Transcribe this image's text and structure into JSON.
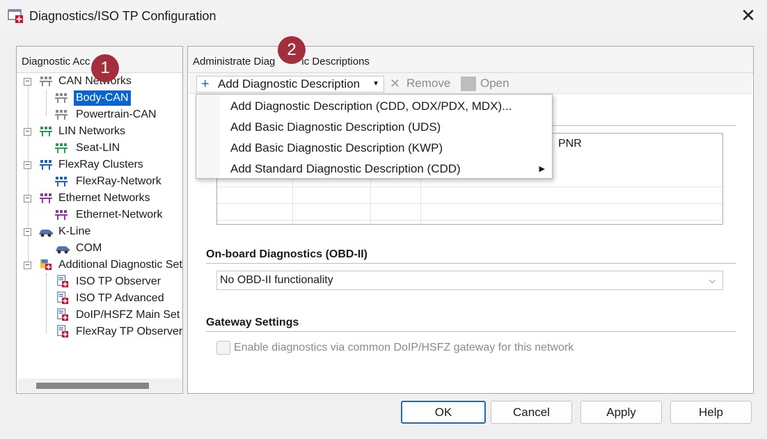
{
  "window": {
    "title": "Diagnostics/ISO TP Configuration",
    "close_label": "✕"
  },
  "left_panel": {
    "title": "Diagnostic Acc",
    "tree": [
      {
        "label": "CAN Networks"
      },
      {
        "label": "Body-CAN"
      },
      {
        "label": "Powertrain-CAN"
      },
      {
        "label": "LIN Networks"
      },
      {
        "label": "Seat-LIN"
      },
      {
        "label": "FlexRay Clusters"
      },
      {
        "label": "FlexRay-Network"
      },
      {
        "label": "Ethernet Networks"
      },
      {
        "label": "Ethernet-Network"
      },
      {
        "label": "K-Line"
      },
      {
        "label": "COM"
      },
      {
        "label": "Additional Diagnostic Set"
      },
      {
        "label": "ISO TP Observer"
      },
      {
        "label": "ISO TP Advanced"
      },
      {
        "label": "DoIP/HSFZ Main Set"
      },
      {
        "label": "FlexRay TP Observer"
      }
    ],
    "selected_index": 1
  },
  "right_panel": {
    "title": "Administrate Diag",
    "title_tail": "ic Descriptions",
    "toolbar": {
      "add_label": "Add Diagnostic Description",
      "remove_label": "Remove",
      "open_label": "Open"
    },
    "menu": [
      "Add Diagnostic Description (CDD, ODX/PDX, MDX)...",
      "Add Basic Diagnostic Description (UDS)",
      "Add Basic Diagnostic Description (KWP)",
      "Add Standard Diagnostic Description (CDD)"
    ],
    "grid": {
      "pnr_header": "PNR"
    },
    "obd": {
      "title": "On-board Diagnostics (OBD-II)",
      "selected": "No OBD-II functionality"
    },
    "gateway": {
      "title": "Gateway Settings",
      "checkbox_label": "Enable diagnostics via common DoIP/HSFZ gateway for this network",
      "checked": false
    }
  },
  "buttons": {
    "ok": "OK",
    "cancel": "Cancel",
    "apply": "Apply",
    "help": "Help"
  },
  "badges": {
    "one": "1",
    "two": "2"
  },
  "colors": {
    "selection": "#0a64cf",
    "badge": "#a32f3d",
    "ok_border": "#1f67c2"
  }
}
